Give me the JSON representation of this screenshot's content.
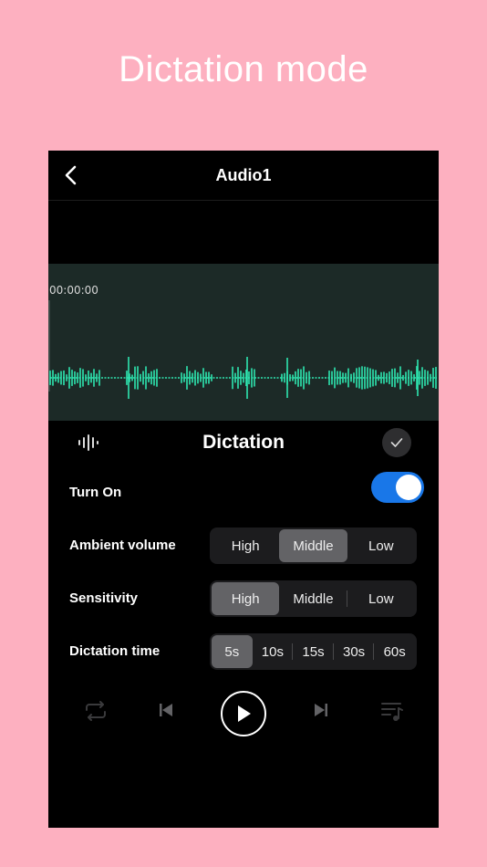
{
  "promo": {
    "title": "Dictation mode"
  },
  "nav": {
    "title": "Audio1",
    "back_icon": "chevron-left-icon"
  },
  "waveform": {
    "timecode": "00:00:00",
    "color": "#2ee6b0"
  },
  "dictation": {
    "title": "Dictation",
    "turn_on": {
      "label": "Turn On",
      "value": true,
      "accent": "#1977e8"
    },
    "ambient_volume": {
      "label": "Ambient volume",
      "options": [
        "High",
        "Middle",
        "Low"
      ],
      "selected": "Middle"
    },
    "sensitivity": {
      "label": "Sensitivity",
      "options": [
        "High",
        "Middle",
        "Low"
      ],
      "selected": "High"
    },
    "dictation_time": {
      "label": "Dictation time",
      "options": [
        "5s",
        "10s",
        "15s",
        "30s",
        "60s"
      ],
      "selected": "5s"
    }
  },
  "player": {
    "icons": [
      "repeat-icon",
      "previous-icon",
      "play-icon",
      "next-icon",
      "playlist-icon"
    ]
  }
}
